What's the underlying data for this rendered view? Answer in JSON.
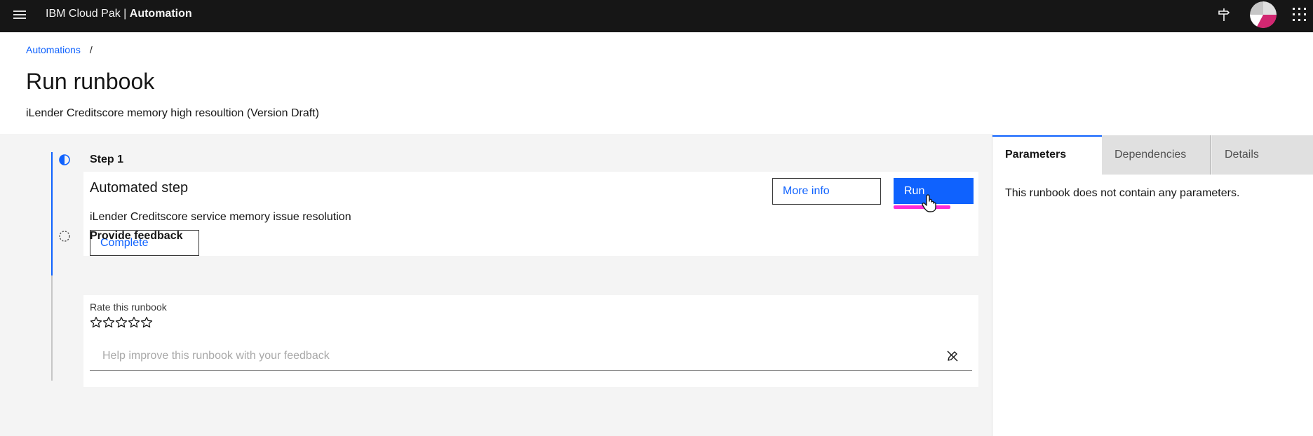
{
  "topbar": {
    "brand_prefix": "IBM Cloud Pak | ",
    "brand_product": "Automation",
    "menu_icon": "hamburger-menu-icon",
    "pin_icon": "pin-icon",
    "avatar": "user-avatar",
    "switcher_icon": "app-switcher-icon"
  },
  "breadcrumb": {
    "items": [
      {
        "label": "Automations"
      }
    ],
    "separator": "/"
  },
  "page": {
    "title": "Run runbook",
    "subtitle": "iLender Creditscore memory high resoultion (Version Draft)"
  },
  "steps": [
    {
      "title": "Step 1",
      "status": "in-progress",
      "card": {
        "title": "Automated step",
        "description": "iLender Creditscore service memory issue resolution",
        "complete_label": "Complete",
        "more_info_label": "More info",
        "run_label": "Run"
      }
    },
    {
      "title": "Provide feedback",
      "status": "not-started",
      "card": {
        "rate_label": "Rate this runbook",
        "star_count": 5,
        "rating": 0,
        "feedback_placeholder": "Help improve this runbook with your feedback"
      }
    }
  ],
  "side_panel": {
    "tabs": [
      {
        "label": "Parameters",
        "active": true
      },
      {
        "label": "Dependencies",
        "active": false
      },
      {
        "label": "Details",
        "active": false
      }
    ],
    "content": "This runbook does not contain any parameters."
  },
  "colors": {
    "accent": "#0f62fe",
    "topbar": "#161616",
    "highlight": "#ff2bd6"
  }
}
